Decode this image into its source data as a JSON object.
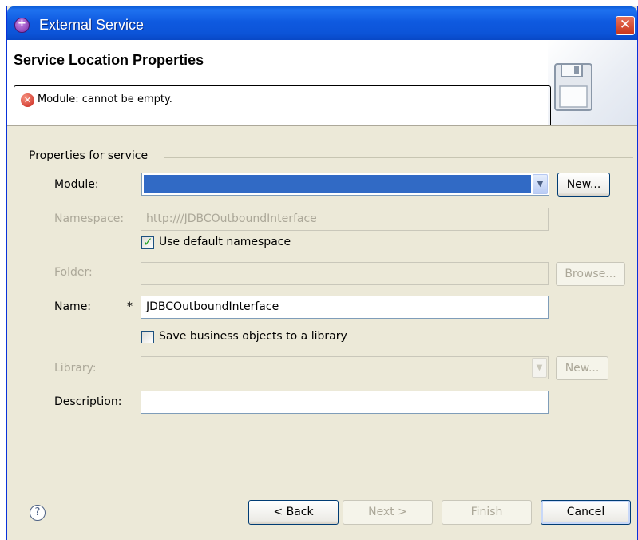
{
  "window": {
    "title": "External Service",
    "close_glyph": "✕"
  },
  "header": {
    "title": "Service Location Properties",
    "error_message": "Module: cannot be empty."
  },
  "group": {
    "label": "Properties for service"
  },
  "fields": {
    "module": {
      "label": "Module:",
      "value": "",
      "new_button": "New..."
    },
    "namespace": {
      "label": "Namespace:",
      "value": "http:///JDBCOutboundInterface"
    },
    "use_default_namespace": {
      "label": "Use default namespace",
      "checked": true
    },
    "folder": {
      "label": "Folder:",
      "value": "",
      "browse_button": "Browse..."
    },
    "name": {
      "label": "Name:",
      "required_marker": "*",
      "value": "JDBCOutboundInterface"
    },
    "save_to_library": {
      "label": "Save business objects to a library",
      "checked": false
    },
    "library": {
      "label": "Library:",
      "value": "",
      "new_button": "New..."
    },
    "description": {
      "label": "Description:",
      "value": ""
    }
  },
  "footer": {
    "help_glyph": "?",
    "back": "< Back",
    "next": "Next >",
    "finish": "Finish",
    "cancel": "Cancel"
  },
  "icons": {
    "app": "eclipse-service-icon",
    "error": "error-icon",
    "banner": "floppy-disk-icon",
    "help": "help-icon",
    "dropdown": "chevron-down-icon"
  },
  "colors": {
    "selection": "#316ac5",
    "titlebar": "#0c54d8",
    "error": "#c8241a",
    "check": "#21a121"
  }
}
